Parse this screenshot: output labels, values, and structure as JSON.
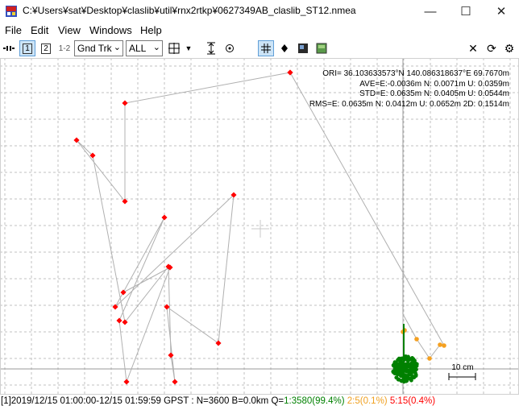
{
  "window": {
    "title": "C:¥Users¥sat¥Desktop¥claslib¥util¥rnx2rtkp¥0627349AB_claslib_ST12.nmea",
    "minimize": "—",
    "maximize": "☐",
    "close": "✕"
  },
  "menu": [
    "File",
    "Edit",
    "View",
    "Windows",
    "Help"
  ],
  "toolbar": {
    "btn1": "1",
    "btn2": "2",
    "btn12": "1-2",
    "plot_type": "Gnd Trk",
    "sat_select": "ALL"
  },
  "stats": {
    "ori": "ORI= 36.103633573°N  140.086318637°E 69.7670m",
    "ave": "AVE=E:-0.0036m N: 0.0071m U: 0.0359m",
    "std": "STD=E: 0.0635m N: 0.0405m U: 0.0544m",
    "rms": "RMS=E: 0.0635m N: 0.0412m U: 0.0652m 2D: 0.1514m"
  },
  "scale_label": "10 cm",
  "status": {
    "prefix": "[1]2019/12/15 01:00:00-12/15 01:59:59 GPST : N=3600 B=0.0km Q=",
    "q1": "1:3580(99.4%)",
    "q2": "2:5(0.1%)",
    "q5": "5:15(0.4%)"
  },
  "colors": {
    "fix": "#008000",
    "float": "#f4a020",
    "single": "#ff0000",
    "grid": "#c0c0c0",
    "line": "#b0b0b0"
  }
}
